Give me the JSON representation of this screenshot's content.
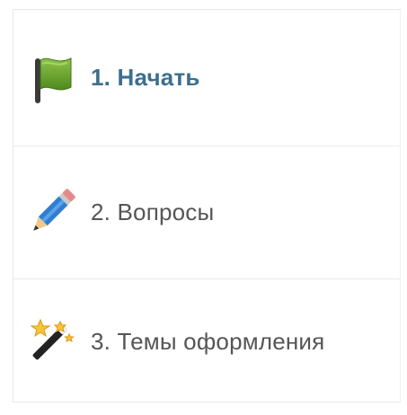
{
  "steps": [
    {
      "label": "1. Начать",
      "icon": "green-flag-icon",
      "active": true
    },
    {
      "label": "2. Вопросы",
      "icon": "pencil-icon",
      "active": false
    },
    {
      "label": "3. Темы оформления",
      "icon": "magic-wand-icon",
      "active": false
    }
  ],
  "colors": {
    "active_text": "#3d6f8e",
    "inactive_text": "#555555",
    "divider": "#ececec"
  }
}
